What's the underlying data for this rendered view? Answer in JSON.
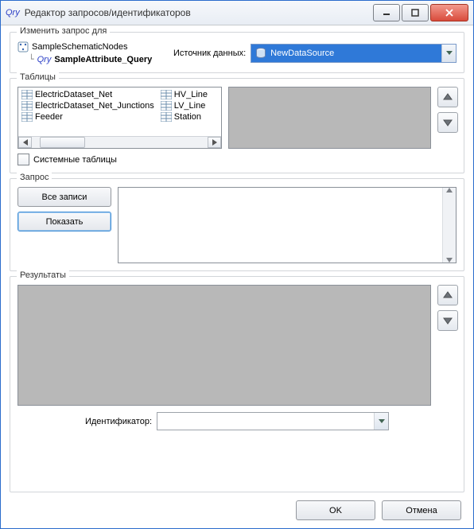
{
  "window": {
    "title": "Редактор запросов/идентификаторов"
  },
  "groups": {
    "change_query": {
      "legend": "Изменить запрос для",
      "tree": {
        "root": "SampleSchematicNodes",
        "child": "SampleAttribute_Query"
      },
      "datasource_label": "Источник данных:",
      "datasource_value": "NewDataSource"
    },
    "tables": {
      "legend": "Таблицы",
      "col1": [
        "ElectricDataset_Net",
        "ElectricDataset_Net_Junctions",
        "Feeder"
      ],
      "col2": [
        "HV_Line",
        "LV_Line",
        "Station"
      ],
      "system_tables": "Системные таблицы"
    },
    "query": {
      "legend": "Запрос",
      "all_records": "Все записи",
      "show": "Показать"
    },
    "results": {
      "legend": "Результаты",
      "identifier_label": "Идентификатор:"
    }
  },
  "footer": {
    "ok": "OK",
    "cancel": "Отмена"
  },
  "qry_prefix": "Qry"
}
